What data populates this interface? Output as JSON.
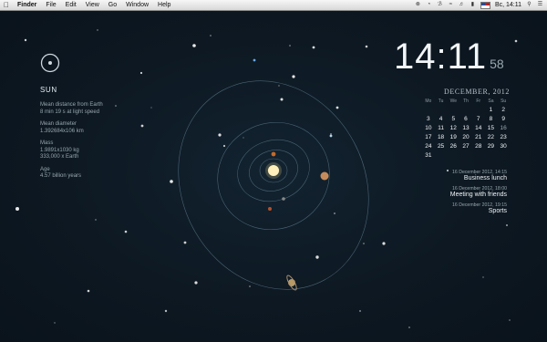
{
  "menubar": {
    "apple_glyph": "",
    "app_name": "Finder",
    "menus": [
      "File",
      "Edit",
      "View",
      "Go",
      "Window",
      "Help"
    ],
    "status": {
      "language": "",
      "clock": "Вс, 14:11"
    }
  },
  "sun_panel": {
    "title": "SUN",
    "facts": [
      {
        "label": "Mean distance from Earth",
        "value": "8 min 19 s at light speed"
      },
      {
        "label": "Mean diameter",
        "value": "1.392684x106 km"
      },
      {
        "label": "Mass",
        "value": "1.9891x1030 kg",
        "value2": "333,000 x Earth"
      },
      {
        "label": "Age",
        "value": "4.57 billion years"
      }
    ]
  },
  "clock": {
    "time": "14:11",
    "seconds": "58"
  },
  "calendar": {
    "month_year": "DECEMBER, 2012",
    "weekdays": [
      "Mo",
      "Tu",
      "We",
      "Th",
      "Fr",
      "Sa",
      "Su"
    ],
    "rows": [
      [
        "",
        "",
        "",
        "",
        "",
        "1",
        "2"
      ],
      [
        "3",
        "4",
        "5",
        "6",
        "7",
        "8",
        "9"
      ],
      [
        "10",
        "11",
        "12",
        "13",
        "14",
        "15",
        "16"
      ],
      [
        "17",
        "18",
        "19",
        "20",
        "21",
        "22",
        "23"
      ],
      [
        "24",
        "25",
        "26",
        "27",
        "28",
        "29",
        "30"
      ],
      [
        "31",
        "",
        "",
        "",
        "",
        "",
        ""
      ]
    ],
    "today": "16"
  },
  "events": [
    {
      "time": "16 December 2012, 14:15",
      "title": "Business lunch"
    },
    {
      "time": "16 December 2012, 18:00",
      "title": "Meeting with friends"
    },
    {
      "time": "16 December 2012, 19:15",
      "title": "Sports"
    }
  ]
}
